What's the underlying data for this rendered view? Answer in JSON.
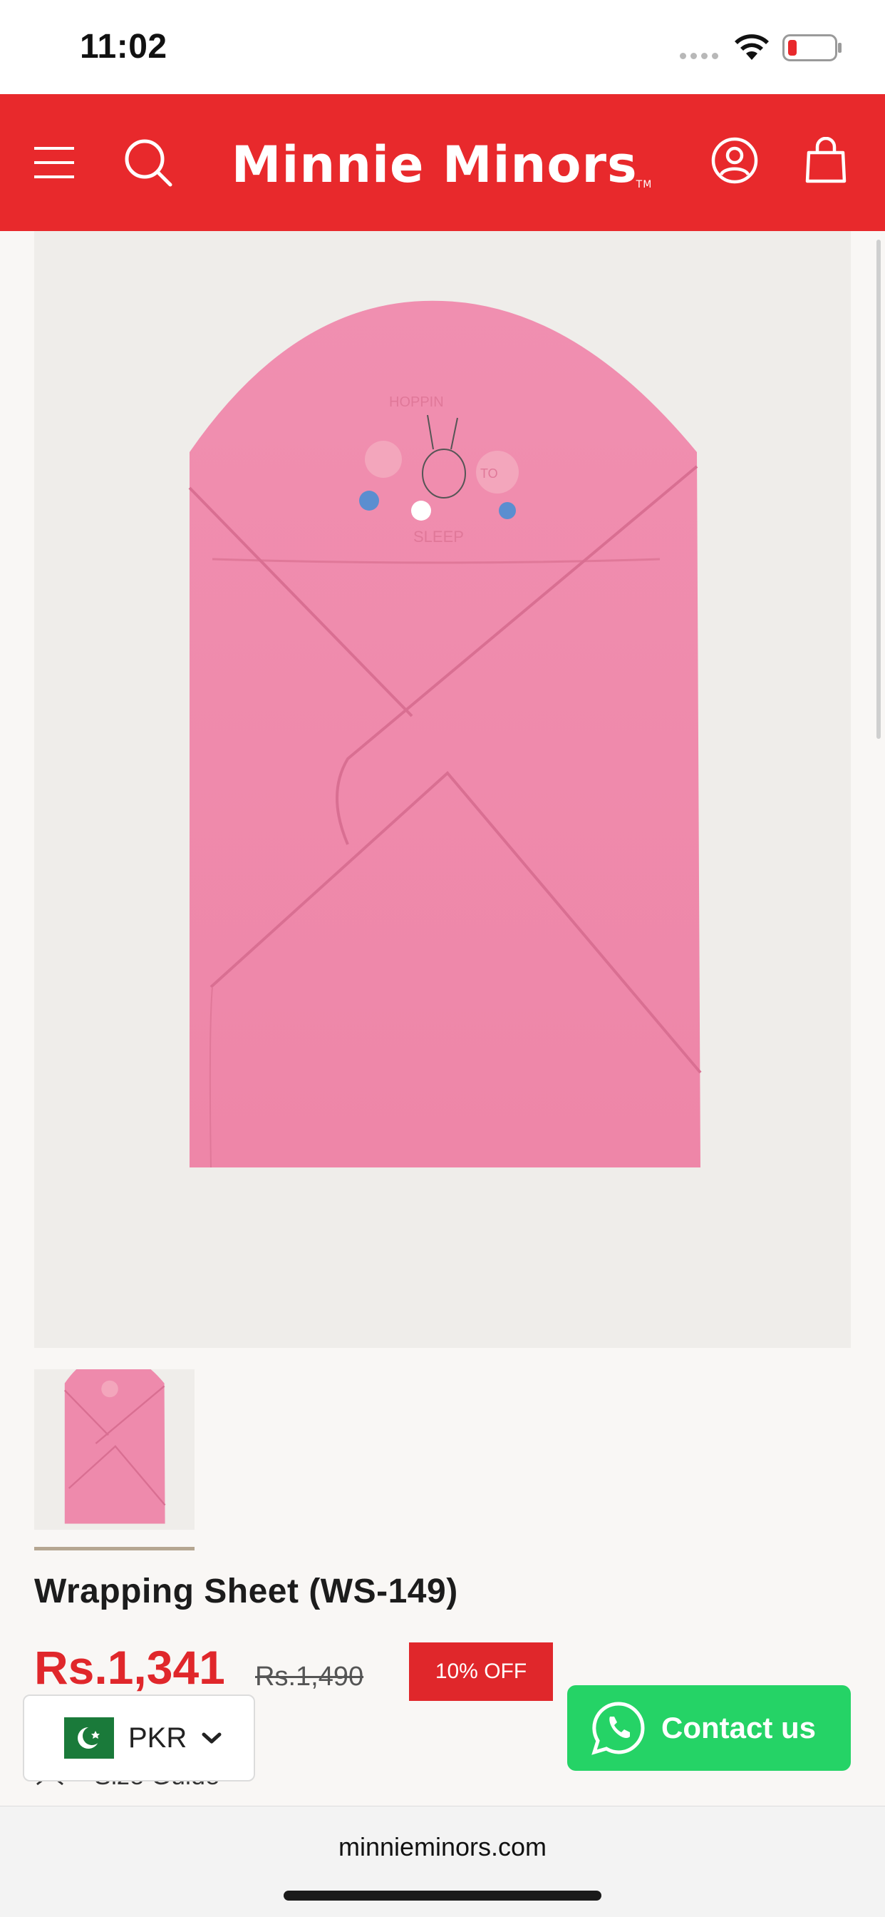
{
  "status_bar": {
    "time": "11:02"
  },
  "header": {
    "brand": "Minnie Minors",
    "trademark": "TM",
    "icons": [
      "menu-icon",
      "search-icon",
      "account-icon",
      "cart-icon"
    ],
    "background_color": "#e8292c"
  },
  "product": {
    "title": "Wrapping Sheet (WS-149)",
    "price": "Rs.1,341",
    "compare_price": "Rs.1,490",
    "discount_badge": "10% OFF",
    "size_guide_label": "Size Guide",
    "image_alt": "Pink hooded wrapping sheet with bunny print",
    "print_text_top": "HOPPIN",
    "print_text_mid": "TO",
    "print_text_bottom": "SLEEP"
  },
  "currency_selector": {
    "code": "PKR",
    "flag": "pakistan-flag-icon"
  },
  "contact": {
    "label": "Contact us",
    "icon": "whatsapp-icon",
    "color": "#25d366"
  },
  "browser": {
    "url": "minnieminors.com"
  }
}
